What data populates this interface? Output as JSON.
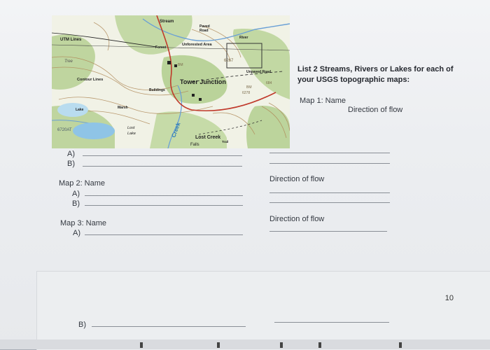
{
  "map": {
    "labels": {
      "stream": "Stream",
      "paved_road": "Paved\nRoad",
      "river": "River",
      "utm_lines": "UTM Lines",
      "forest": "Forest",
      "unforested_area": "Unforested Area",
      "tree": "Tree",
      "contour_lines": "Contour Lines",
      "unpaved_road": "Unpaved Road",
      "tower_junction": "Tower Junction",
      "buildings": "Buildings",
      "lake": "Lake",
      "marsh": "Marsh",
      "lost_lake": "Lost\nLake",
      "creek": "Creek",
      "lost_creek": "Lost Creek",
      "falls": "Falls",
      "trail": "Trail",
      "elev_left": "6720AT",
      "bm": "BM",
      "elev_678": "6267",
      "bm2": "BM",
      "elev_6278": "6278",
      "rd_684": "684"
    }
  },
  "instructions": "List 2 Streams, Rivers or Lakes for each of your USGS topographic maps:",
  "map1": {
    "name_label": "Map 1: Name",
    "direction_label": "Direction of flow",
    "a": "A)",
    "b": "B)"
  },
  "map2": {
    "name_label": "Map 2: Name",
    "direction_label": "Direction of flow",
    "a": "A)",
    "b": "B)"
  },
  "map3": {
    "name_label": "Map 3: Name",
    "direction_label": "Direction of flow",
    "a": "A)",
    "b": "B)"
  },
  "page_number": "10"
}
